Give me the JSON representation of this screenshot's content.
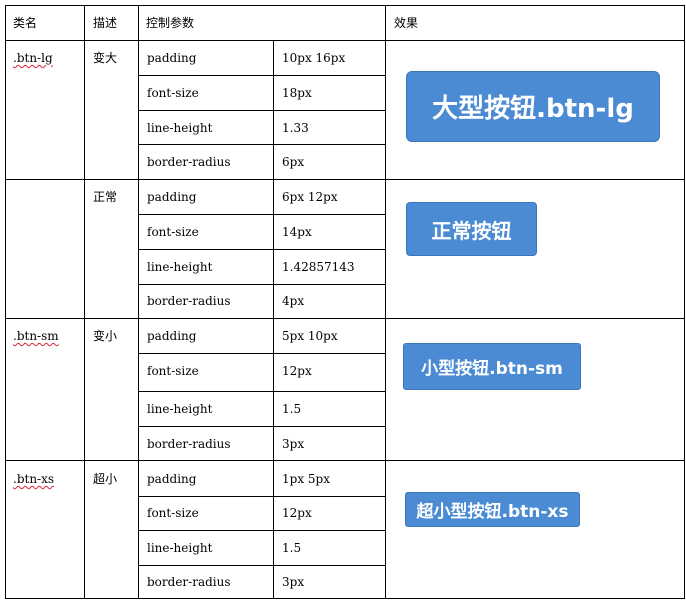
{
  "header": {
    "class_name": "类名",
    "description": "描述",
    "control_params": "控制参数",
    "effect": "效果"
  },
  "rows": [
    {
      "class_name": ".btn-lg",
      "description": "变大",
      "params": [
        {
          "name": "padding",
          "value": "10px 16px"
        },
        {
          "name": "font-size",
          "value": "18px"
        },
        {
          "name": "line-height",
          "value": "1.33"
        },
        {
          "name": "border-radius",
          "value": "6px"
        }
      ],
      "demo_label": "大型按钮.btn-lg"
    },
    {
      "class_name": "",
      "description": "正常",
      "params": [
        {
          "name": "padding",
          "value": "6px 12px"
        },
        {
          "name": "font-size",
          "value": "14px"
        },
        {
          "name": "line-height",
          "value": "1.42857143"
        },
        {
          "name": "border-radius",
          "value": "4px"
        }
      ],
      "demo_label": "正常按钮"
    },
    {
      "class_name": ".btn-sm",
      "description": "变小",
      "params": [
        {
          "name": "padding",
          "value": "5px 10px"
        },
        {
          "name": "font-size",
          "value": "12px"
        },
        {
          "name": "line-height",
          "value": "1.5"
        },
        {
          "name": "border-radius",
          "value": "3px"
        }
      ],
      "demo_label": "小型按钮.btn-sm"
    },
    {
      "class_name": ".btn-xs",
      "description": "超小",
      "params": [
        {
          "name": "padding",
          "value": "1px 5px"
        },
        {
          "name": "font-size",
          "value": "12px"
        },
        {
          "name": "line-height",
          "value": "1.5"
        },
        {
          "name": "border-radius",
          "value": "3px"
        }
      ],
      "demo_label": "超小型按钮.btn-xs"
    }
  ],
  "colors": {
    "button_fill": "#4a8bd4",
    "button_border": "#3a76bb",
    "button_text": "#ffffff",
    "grid": "#000000"
  }
}
